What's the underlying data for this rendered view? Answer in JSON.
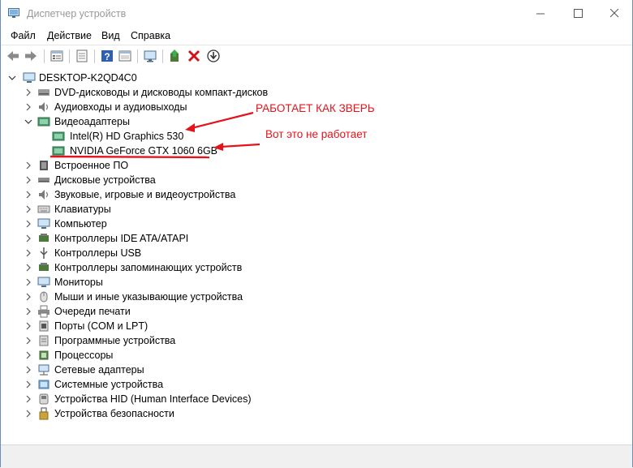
{
  "window": {
    "title": "Диспетчер устройств",
    "buttons": [
      "minimize",
      "maximize",
      "close"
    ]
  },
  "menu": [
    {
      "label": "Файл"
    },
    {
      "label": "Действие"
    },
    {
      "label": "Вид"
    },
    {
      "label": "Справка"
    }
  ],
  "toolbar": {
    "icons": [
      "back-icon",
      "forward-icon",
      "properties-list-icon",
      "show-hidden-icon",
      "help-icon",
      "view-icon",
      "monitor-icon",
      "update-driver-icon",
      "uninstall-icon",
      "download-icon"
    ]
  },
  "tree": {
    "root": "DESKTOP-K2QD4C0",
    "categories": [
      {
        "label": "DVD-дисководы и дисководы компакт-дисков",
        "icon": "dvd-icon"
      },
      {
        "label": "Аудиовходы и аудиовыходы",
        "icon": "audio-icon"
      },
      {
        "label": "Видеоадаптеры",
        "icon": "display-adapter-icon",
        "expanded": true,
        "children": [
          {
            "label": "Intel(R) HD Graphics 530",
            "icon": "display-adapter-icon"
          },
          {
            "label": "NVIDIA GeForce GTX 1060 6GB",
            "icon": "display-adapter-icon"
          }
        ]
      },
      {
        "label": "Встроенное ПО",
        "icon": "firmware-icon"
      },
      {
        "label": "Дисковые устройства",
        "icon": "disk-icon"
      },
      {
        "label": "Звуковые, игровые и видеоустройства",
        "icon": "sound-icon"
      },
      {
        "label": "Клавиатуры",
        "icon": "keyboard-icon"
      },
      {
        "label": "Компьютер",
        "icon": "computer-icon"
      },
      {
        "label": "Контроллеры IDE ATA/ATAPI",
        "icon": "ide-icon"
      },
      {
        "label": "Контроллеры USB",
        "icon": "usb-icon"
      },
      {
        "label": "Контроллеры запоминающих устройств",
        "icon": "storage-icon"
      },
      {
        "label": "Мониторы",
        "icon": "monitor-icon"
      },
      {
        "label": "Мыши и иные указывающие устройства",
        "icon": "mouse-icon"
      },
      {
        "label": "Очереди печати",
        "icon": "printer-icon"
      },
      {
        "label": "Порты (COM и LPT)",
        "icon": "port-icon"
      },
      {
        "label": "Программные устройства",
        "icon": "software-device-icon"
      },
      {
        "label": "Процессоры",
        "icon": "cpu-icon"
      },
      {
        "label": "Сетевые адаптеры",
        "icon": "network-icon"
      },
      {
        "label": "Системные устройства",
        "icon": "system-icon"
      },
      {
        "label": "Устройства HID (Human Interface Devices)",
        "icon": "hid-icon"
      },
      {
        "label": "Устройства безопасности",
        "icon": "security-icon"
      }
    ]
  },
  "annotations": {
    "works": "РАБОТАЕТ КАК ЗВЕРЬ",
    "not_works": "Вот это не работает",
    "color": "#e3141b"
  }
}
